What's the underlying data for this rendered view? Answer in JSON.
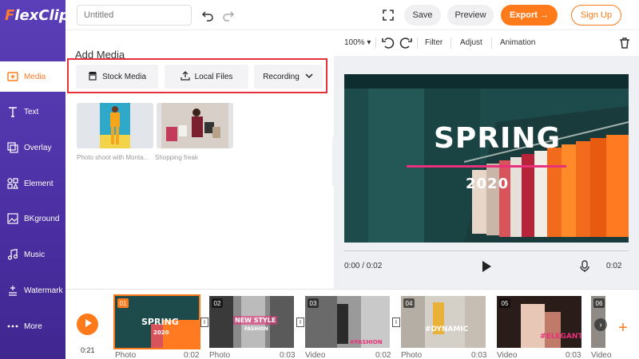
{
  "app": {
    "logo": "FlexClip"
  },
  "sidebar": {
    "items": [
      {
        "label": "Media",
        "icon": "media-icon"
      },
      {
        "label": "Text",
        "icon": "text-icon"
      },
      {
        "label": "Overlay",
        "icon": "overlay-icon"
      },
      {
        "label": "Element",
        "icon": "element-icon"
      },
      {
        "label": "BKground",
        "icon": "background-icon"
      },
      {
        "label": "Music",
        "icon": "music-icon"
      },
      {
        "label": "Watermark",
        "icon": "watermark-icon"
      },
      {
        "label": "More",
        "icon": "more-icon"
      }
    ]
  },
  "topbar": {
    "title_placeholder": "Untitled",
    "save": "Save",
    "preview": "Preview",
    "export": "Export →",
    "signup": "Sign Up"
  },
  "panel": {
    "title": "Add Media",
    "tabs": {
      "stock": "Stock Media",
      "local": "Local Files",
      "recording": "Recording"
    },
    "media": [
      {
        "label": "Photo shoot with Monta..."
      },
      {
        "label": "Shopping freak"
      }
    ]
  },
  "editor": {
    "zoom": "100%",
    "filter": "Filter",
    "adjust": "Adjust",
    "animation": "Animation",
    "preview_title": "SPRING",
    "preview_year": "2020",
    "time_current": "0:00 / 0:02",
    "time_total": "0:02"
  },
  "timeline": {
    "total": "0:21",
    "clips": [
      {
        "num": "01",
        "type": "Photo",
        "duration": "0:02",
        "label": "SPRING",
        "sub": "2020"
      },
      {
        "num": "02",
        "type": "Photo",
        "duration": "0:03",
        "label": "NEW STYLE",
        "sub": "FASHION"
      },
      {
        "num": "03",
        "type": "Video",
        "duration": "0:02",
        "label": "#FASHION",
        "sub": ""
      },
      {
        "num": "04",
        "type": "Photo",
        "duration": "0:03",
        "label": "#DYNAMIC",
        "sub": ""
      },
      {
        "num": "05",
        "type": "Video",
        "duration": "0:03",
        "label": "#ELEGANT",
        "sub": ""
      },
      {
        "num": "06",
        "type": "Video",
        "duration": "",
        "label": "",
        "sub": ""
      }
    ]
  },
  "colors": {
    "accent": "#ff7a1a",
    "sidebar": "#4b2fa3",
    "highlight": "#e8313a"
  }
}
